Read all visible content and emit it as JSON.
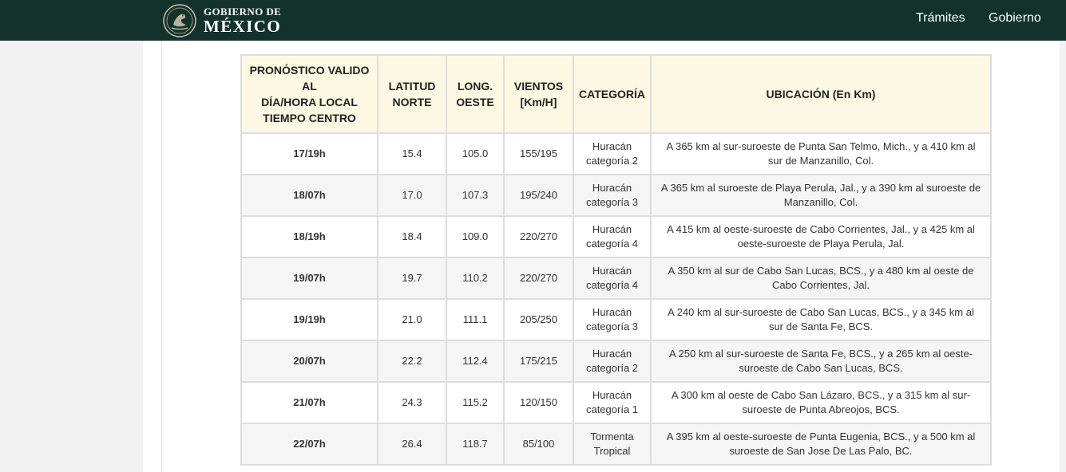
{
  "header": {
    "logo_line1": "GOBIERNO DE",
    "logo_line2": "MÉXICO",
    "nav": [
      "Trámites",
      "Gobierno"
    ],
    "background_color": "#13322b",
    "seal_icon": "mexico-seal-icon"
  },
  "table": {
    "headers": [
      [
        "PRONÓSTICO VALIDO",
        "AL",
        "DÍA/HORA LOCAL",
        "TIEMPO CENTRO"
      ],
      [
        "LATITUD",
        "NORTE"
      ],
      [
        "LONG.",
        "OESTE"
      ],
      [
        "VIENTOS",
        "[Km/H]"
      ],
      [
        "CATEGORÍA"
      ],
      [
        "UBICACIÓN (En Km)"
      ]
    ],
    "header_background": "#fcf8e3",
    "rows": [
      {
        "fecha": "17/19h",
        "lat": "15.4",
        "lon": "105.0",
        "vientos": "155/195",
        "categoria": [
          "Huracán",
          "categoría 2"
        ],
        "ubicacion": [
          "A 365 km al sur-suroeste de Punta San Telmo, Mich., y a 410 km al",
          "sur de Manzanillo, Col."
        ]
      },
      {
        "fecha": "18/07h",
        "lat": "17.0",
        "lon": "107.3",
        "vientos": "195/240",
        "categoria": [
          "Huracán",
          "categoría 3"
        ],
        "ubicacion": [
          "A 365 km al suroeste de Playa Perula, Jal., y a 390 km al suroeste de",
          "Manzanillo, Col."
        ]
      },
      {
        "fecha": "18/19h",
        "lat": "18.4",
        "lon": "109.0",
        "vientos": "220/270",
        "categoria": [
          "Huracán",
          "categoría 4"
        ],
        "ubicacion": [
          "A 415 km al oeste-suroeste de Cabo Corrientes, Jal., y a 425 km al",
          "oeste-suroeste de Playa Perula, Jal."
        ]
      },
      {
        "fecha": "19/07h",
        "lat": "19.7",
        "lon": "110.2",
        "vientos": "220/270",
        "categoria": [
          "Huracán",
          "categoría 4"
        ],
        "ubicacion": [
          "A 350 km al sur de Cabo San Lucas, BCS., y a 480 km al oeste de",
          "Cabo Corrientes, Jal."
        ]
      },
      {
        "fecha": "19/19h",
        "lat": "21.0",
        "lon": "111.1",
        "vientos": "205/250",
        "categoria": [
          "Huracán",
          "categoría 3"
        ],
        "ubicacion": [
          "A 240 km al sur-suroeste de Cabo San Lucas, BCS., y a 345 km al",
          "sur de Santa Fe, BCS."
        ]
      },
      {
        "fecha": "20/07h",
        "lat": "22.2",
        "lon": "112.4",
        "vientos": "175/215",
        "categoria": [
          "Huracán",
          "categoría 2"
        ],
        "ubicacion": [
          "A 250 km al sur-suroeste de Santa Fe, BCS., y a 265 km al oeste-",
          "suroeste de Cabo San Lucas, BCS."
        ]
      },
      {
        "fecha": "21/07h",
        "lat": "24.3",
        "lon": "115.2",
        "vientos": "120/150",
        "categoria": [
          "Huracán",
          "categoría 1"
        ],
        "ubicacion": [
          "A 300 km al oeste de Cabo San Lázaro, BCS., y a 315 km al sur-",
          "suroeste de Punta Abreojos, BCS."
        ]
      },
      {
        "fecha": "22/07h",
        "lat": "26.4",
        "lon": "118.7",
        "vientos": "85/100",
        "categoria": [
          "Tormenta",
          "Tropical"
        ],
        "ubicacion": [
          "A 395 km al oeste-suroeste de Punta Eugenia, BCS., y a 500 km al",
          "suroeste de San Jose De Las Palo, BC."
        ]
      }
    ]
  }
}
